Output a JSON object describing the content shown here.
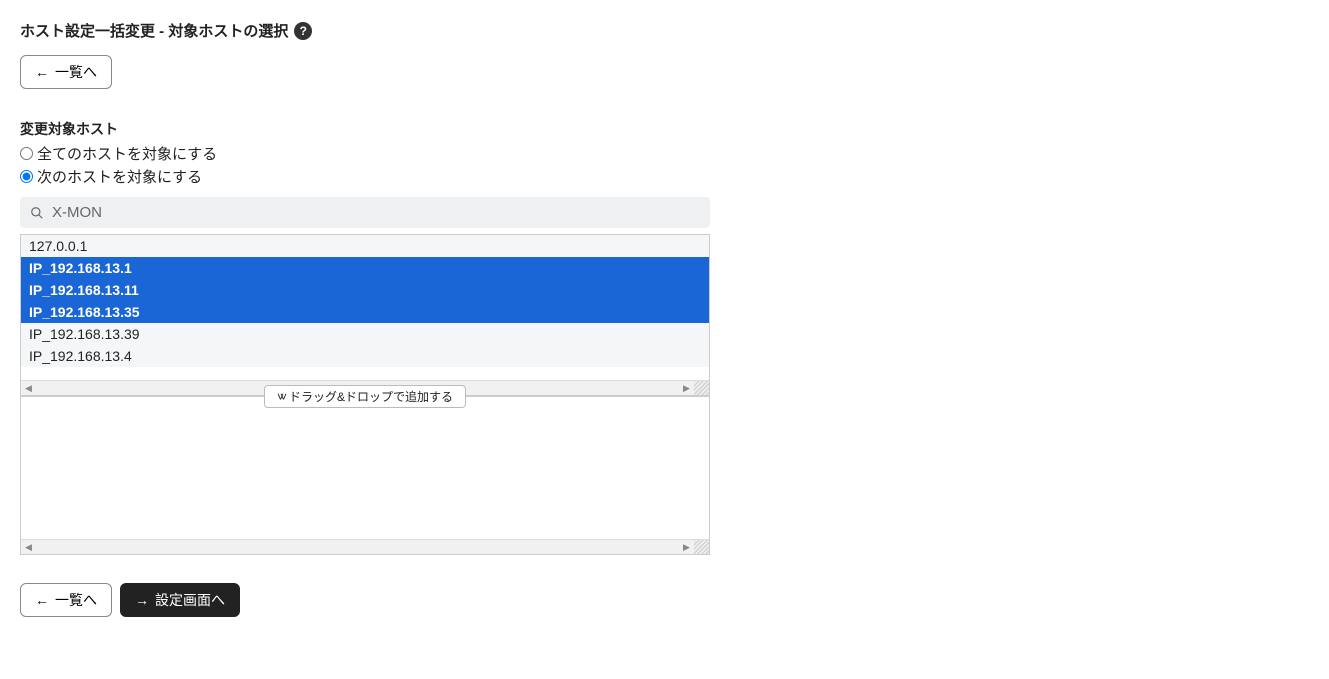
{
  "page": {
    "title": "ホスト設定一括変更 - 対象ホストの選択"
  },
  "buttons": {
    "back_to_list": "一覧へ",
    "to_settings": "設定画面へ"
  },
  "section": {
    "target_hosts_label": "変更対象ホスト",
    "radio_all": "全てのホストを対象にする",
    "radio_next": "次のホストを対象にする"
  },
  "search": {
    "value": "X-MON"
  },
  "dragdrop": {
    "label": "ドラッグ&ドロップで追加する"
  },
  "hosts": [
    {
      "label": "127.0.0.1",
      "selected": false
    },
    {
      "label": "IP_192.168.13.1",
      "selected": true
    },
    {
      "label": "IP_192.168.13.11",
      "selected": true
    },
    {
      "label": "IP_192.168.13.35",
      "selected": true
    },
    {
      "label": "IP_192.168.13.39",
      "selected": false
    },
    {
      "label": "IP_192.168.13.4",
      "selected": false
    }
  ]
}
